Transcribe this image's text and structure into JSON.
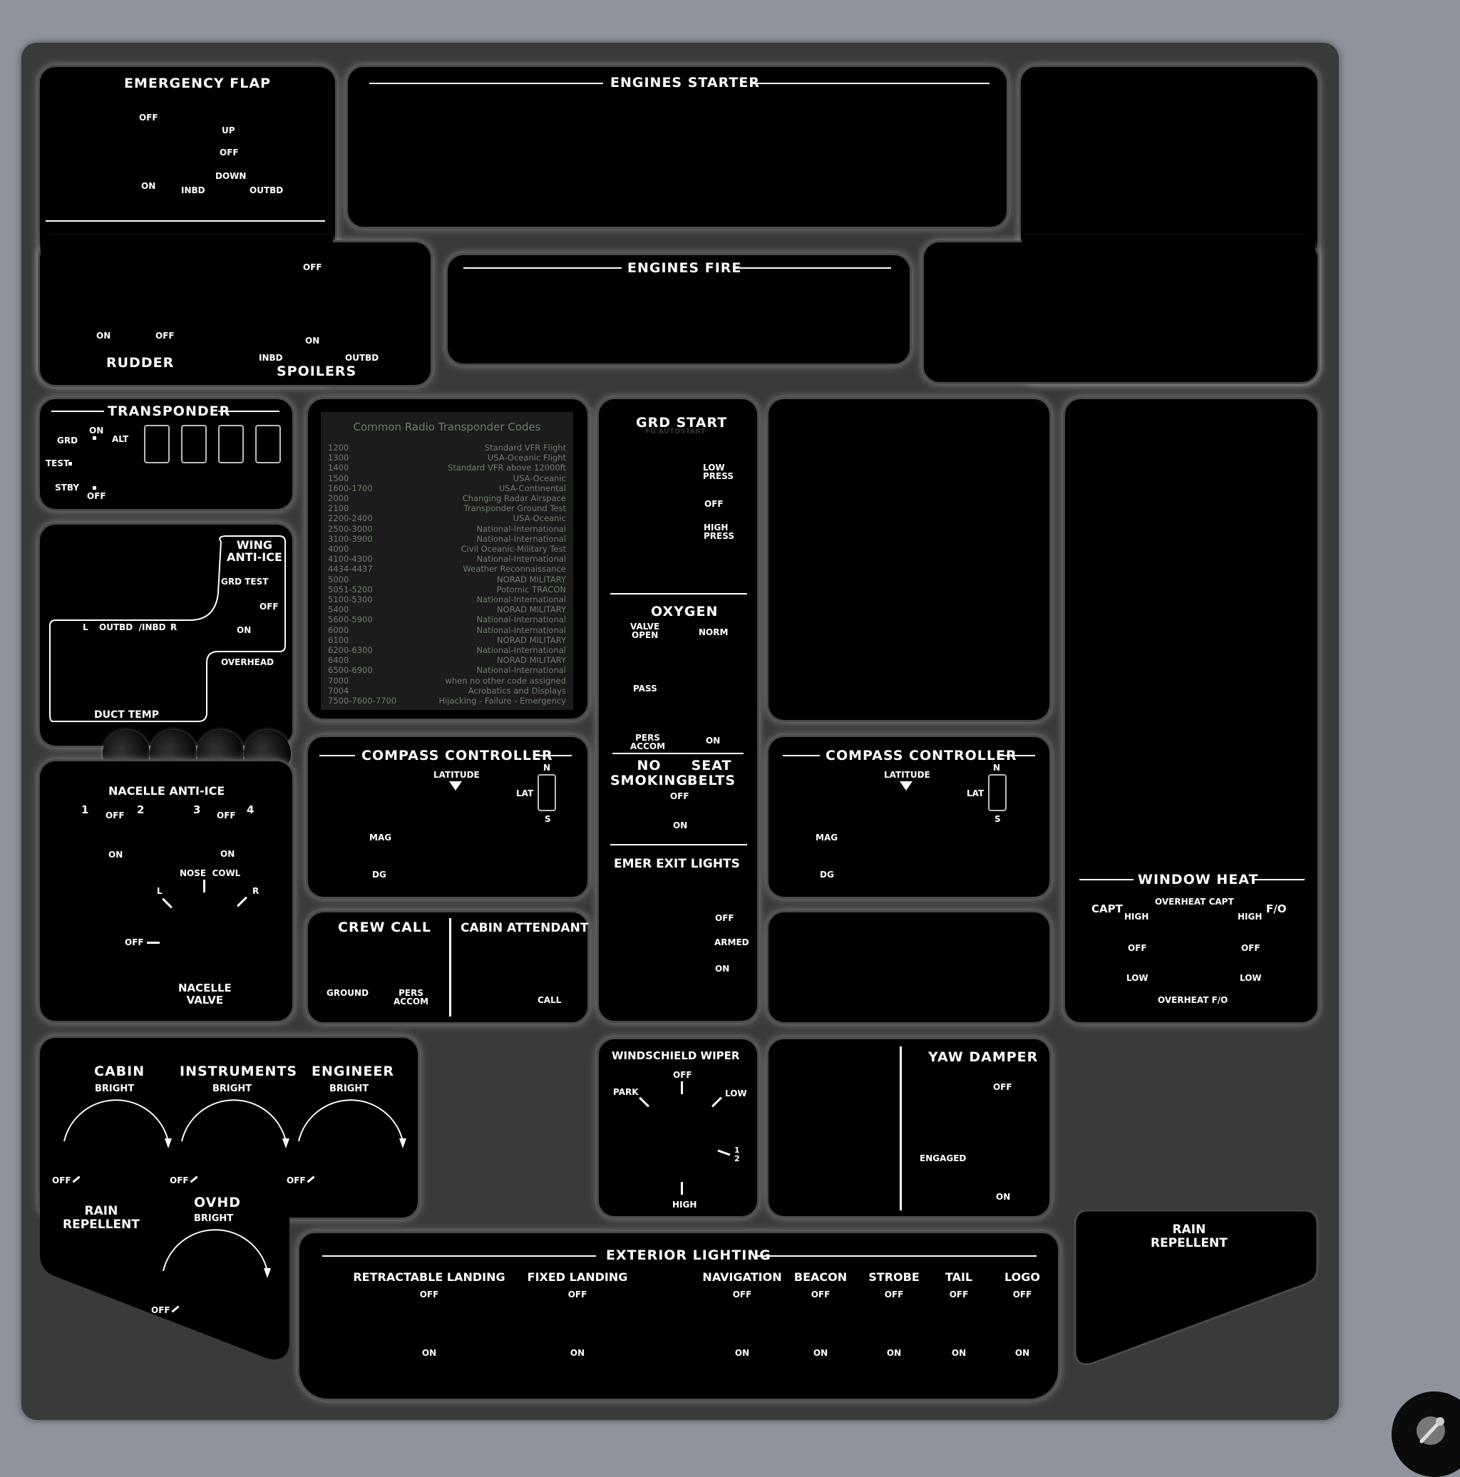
{
  "emergency_flap": {
    "title": "EMERGENCY FLAP",
    "off": "OFF",
    "on": "ON",
    "up": "UP",
    "off2": "OFF",
    "down": "DOWN",
    "inbd": "INBD",
    "outbd": "OUTBD"
  },
  "rudder_spoilers": {
    "rudder": "RUDDER",
    "spoilers": "SPOILERS",
    "on": "ON",
    "off": "OFF",
    "spoiler_off": "OFF",
    "spoiler_on": "ON",
    "inbd": "INBD",
    "outbd": "OUTBD"
  },
  "engines_starter": {
    "title": "ENGINES STARTER"
  },
  "engines_fire": {
    "title": "ENGINES FIRE"
  },
  "transponder": {
    "title": "TRANSPONDER",
    "grd": "GRD",
    "on": "ON",
    "alt": "ALT",
    "test": "TEST",
    "stby": "STBY",
    "off": "OFF"
  },
  "transponder_codes": {
    "title": "Common Radio Transponder Codes",
    "rows": [
      [
        "1200",
        "Standard VFR Flight"
      ],
      [
        "1300",
        "USA-Oceanic Flight"
      ],
      [
        "1400",
        "Standard VFR above 12000ft"
      ],
      [
        "1500",
        "USA-Oceanic"
      ],
      [
        "1600-1700",
        "USA-Continental"
      ],
      [
        "2000",
        "Changing Radar Airspace"
      ],
      [
        "2100",
        "Transponder Ground Test"
      ],
      [
        "2200-2400",
        "USA-Oceanic"
      ],
      [
        "2500-3000",
        "National-International"
      ],
      [
        "3100-3900",
        "National-International"
      ],
      [
        "4000",
        "Civil Oceanic-Military Test"
      ],
      [
        "4100-4300",
        "National-International"
      ],
      [
        "4434-4437",
        "Weather Reconnaissance"
      ],
      [
        "5000",
        "NORAD MILITARY"
      ],
      [
        "5051-5200",
        "Potomic TRACON"
      ],
      [
        "5100-5300",
        "National-International"
      ],
      [
        "5400",
        "NORAD MILITARY"
      ],
      [
        "5600-5900",
        "National-International"
      ],
      [
        "6000",
        "National-International"
      ],
      [
        "6100",
        "NORAD MILITARY"
      ],
      [
        "6200-6300",
        "National-International"
      ],
      [
        "6400",
        "NORAD MILITARY"
      ],
      [
        "6500-6900",
        "National-International"
      ],
      [
        "7000",
        "when no other code assigned"
      ],
      [
        "7004",
        "Acrobatics and Displays"
      ],
      [
        "7500-7600-7700",
        "Hijacking - Failure - Emergency"
      ]
    ]
  },
  "grd_start": {
    "title": "GRD START",
    "subtitle": "FG AUTOSTART",
    "low_press": "LOW\nPRESS",
    "off": "OFF",
    "high_press": "HIGH\nPRESS"
  },
  "oxygen": {
    "title": "OXYGEN",
    "valve_open": "VALVE\nOPEN",
    "norm": "NORM",
    "pass": "PASS",
    "pers_accom": "PERS\nACCOM",
    "on": "ON"
  },
  "signs": {
    "no_smoking": "NO\nSMOKING",
    "seat_belts": "SEAT\nBELTS",
    "off": "OFF",
    "on": "ON"
  },
  "emer_exit": {
    "title": "EMER EXIT LIGHTS",
    "off": "OFF",
    "armed": "ARMED",
    "on": "ON"
  },
  "wing_anti_ice": {
    "title": "WING\nANTI-ICE",
    "grd_test": "GRD TEST",
    "off": "OFF",
    "on": "ON",
    "overhead": "OVERHEAD",
    "l": "L",
    "outbd_inbd": "OUTBD  /INBD",
    "r": "R",
    "duct_temp": "DUCT TEMP"
  },
  "nacelle": {
    "title": "NACELLE ANTI-ICE",
    "n1": "1",
    "off1": "OFF",
    "n2": "2",
    "n3": "3",
    "off2": "OFF",
    "n4": "4",
    "on1": "ON",
    "on2": "ON",
    "nose_cowl": "NOSE  COWL",
    "l": "L",
    "r": "R",
    "off": "OFF",
    "valve": "NACELLE\nVALVE"
  },
  "compass_left": {
    "title": "COMPASS CONTROLLER",
    "latitude": "LATITUDE",
    "lat": "LAT",
    "n": "N",
    "s": "S",
    "mag": "MAG",
    "dg": "DG"
  },
  "compass_right": {
    "title": "COMPASS CONTROLLER",
    "latitude": "LATITUDE",
    "lat": "LAT",
    "n": "N",
    "s": "S",
    "mag": "MAG",
    "dg": "DG"
  },
  "crew_call": {
    "title": "CREW CALL",
    "ground": "GROUND",
    "pers_accom": "PERS\nACCOM",
    "cabin_attendant": "CABIN ATTENDANT",
    "call": "CALL"
  },
  "window_heat": {
    "title": "WINDOW HEAT",
    "capt": "CAPT",
    "fo": "F/O",
    "overheat_capt": "OVERHEAT CAPT",
    "overheat_fo": "OVERHEAT F/O",
    "high_l": "HIGH",
    "high_r": "HIGH",
    "off_l": "OFF",
    "off_r": "OFF",
    "low_l": "LOW",
    "low_r": "LOW"
  },
  "lights_panel": {
    "cabin": "CABIN",
    "instruments": "INSTRUMENTS",
    "engineer": "ENGINEER",
    "ovhd": "OVHD",
    "bright": "BRIGHT",
    "off": "OFF",
    "rain_repellent": "RAIN\nREPELLENT"
  },
  "wiper": {
    "title": "WINDSCHIELD WIPER",
    "off": "OFF",
    "park": "PARK",
    "low": "LOW",
    "half": "1\n2",
    "high": "HIGH"
  },
  "yaw_damper": {
    "title": "YAW DAMPER",
    "off": "OFF",
    "engaged": "ENGAGED",
    "on": "ON"
  },
  "rain_repellent_right": {
    "title": "RAIN\nREPELLENT"
  },
  "exterior": {
    "title": "EXTERIOR LIGHTING",
    "items": [
      {
        "label": "RETRACTABLE LANDING",
        "off": "OFF",
        "on": "ON"
      },
      {
        "label": "FIXED LANDING",
        "off": "OFF",
        "on": "ON"
      },
      {
        "label": "NAVIGATION",
        "off": "OFF",
        "on": "ON"
      },
      {
        "label": "BEACON",
        "off": "OFF",
        "on": "ON"
      },
      {
        "label": "STROBE",
        "off": "OFF",
        "on": "ON"
      },
      {
        "label": "TAIL",
        "off": "OFF",
        "on": "ON"
      },
      {
        "label": "LOGO",
        "off": "OFF",
        "on": "ON"
      }
    ]
  },
  "colors": {
    "background": "#8e939d",
    "board": "#3a3a3a",
    "panel": "#000000",
    "code_text": "#6d7d6a"
  },
  "corner_icon": "settings-wrench-icon"
}
